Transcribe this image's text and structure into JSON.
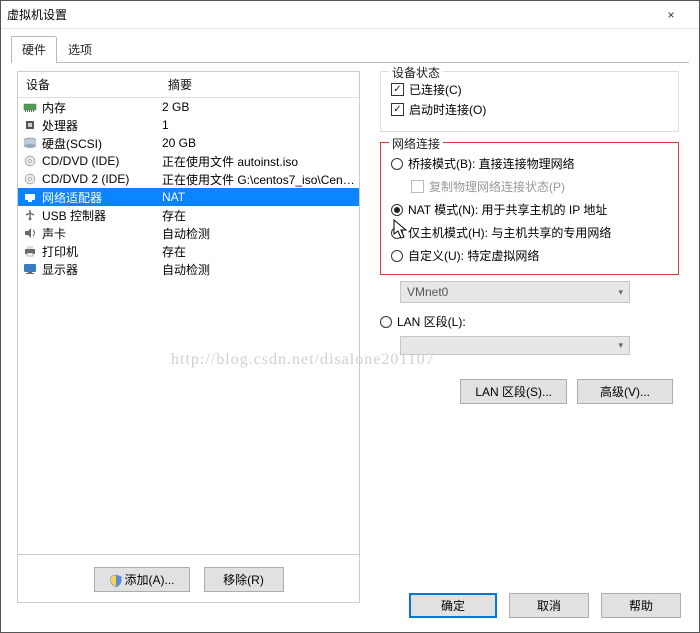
{
  "window": {
    "title": "虚拟机设置",
    "close_icon": "×"
  },
  "tabs": {
    "hardware": "硬件",
    "options": "选项"
  },
  "device_table": {
    "header_device": "设备",
    "header_summary": "摘要",
    "rows": [
      {
        "icon": "memory-icon",
        "name": "内存",
        "summary": "2 GB"
      },
      {
        "icon": "cpu-icon",
        "name": "处理器",
        "summary": "1"
      },
      {
        "icon": "disk-icon",
        "name": "硬盘(SCSI)",
        "summary": "20 GB"
      },
      {
        "icon": "cd-icon",
        "name": "CD/DVD (IDE)",
        "summary": "正在使用文件 autoinst.iso"
      },
      {
        "icon": "cd-icon",
        "name": "CD/DVD 2 (IDE)",
        "summary": "正在使用文件 G:\\centos7_iso\\Cent..."
      },
      {
        "icon": "network-icon",
        "name": "网络适配器",
        "summary": "NAT",
        "selected": true
      },
      {
        "icon": "usb-icon",
        "name": "USB 控制器",
        "summary": "存在"
      },
      {
        "icon": "sound-icon",
        "name": "声卡",
        "summary": "自动检测"
      },
      {
        "icon": "printer-icon",
        "name": "打印机",
        "summary": "存在"
      },
      {
        "icon": "display-icon",
        "name": "显示器",
        "summary": "自动检测"
      }
    ]
  },
  "left_buttons": {
    "add": "添加(A)...",
    "remove": "移除(R)"
  },
  "device_status": {
    "legend": "设备状态",
    "connected": "已连接(C)",
    "connect_at_power_on": "启动时连接(O)"
  },
  "network": {
    "legend": "网络连接",
    "bridged": "桥接模式(B): 直接连接物理网络",
    "replicate": "复制物理网络连接状态(P)",
    "nat": "NAT 模式(N): 用于共享主机的 IP 地址",
    "hostonly": "仅主机模式(H): 与主机共享的专用网络",
    "custom": "自定义(U): 特定虚拟网络",
    "custom_value": "VMnet0",
    "lan_segment": "LAN 区段(L):",
    "lan_value": ""
  },
  "right_buttons": {
    "lan_segments": "LAN 区段(S)...",
    "advanced": "高级(V)..."
  },
  "footer": {
    "ok": "确定",
    "cancel": "取消",
    "help": "帮助"
  },
  "watermark": "http://blog.csdn.net/disalone201107"
}
